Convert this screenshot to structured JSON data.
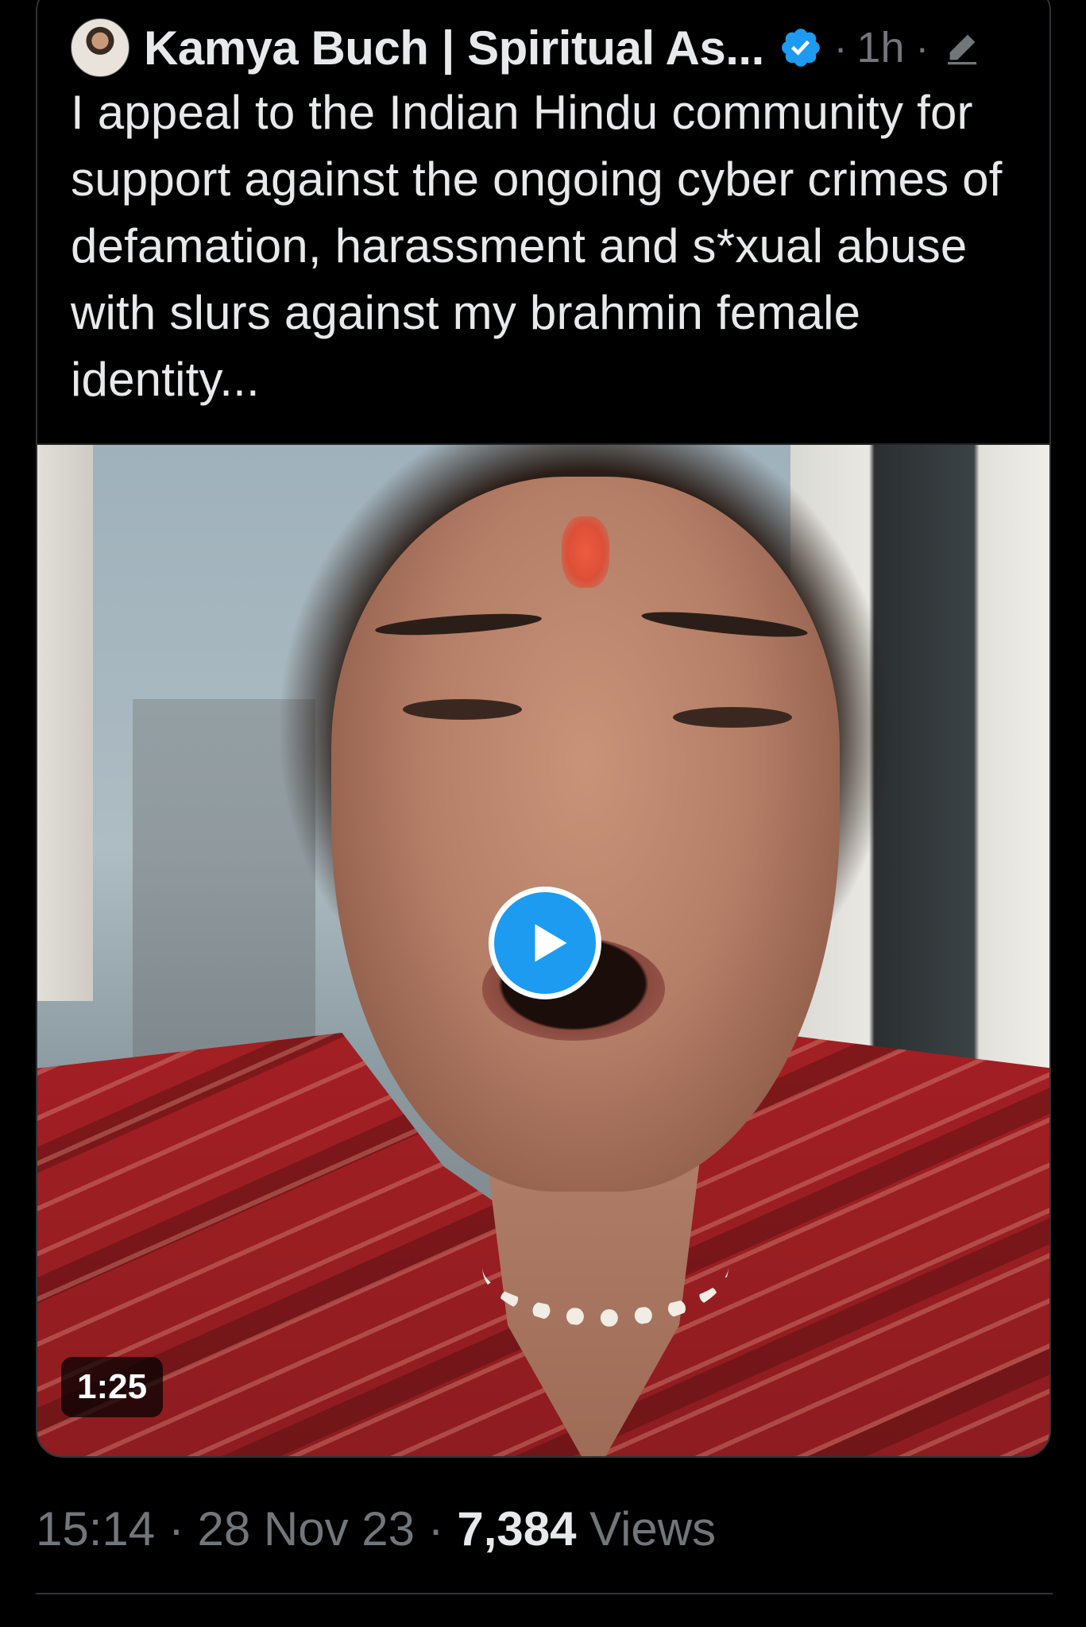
{
  "quoted_tweet": {
    "author_display_name": "Kamya Buch | Spiritual As...",
    "time_ago": "1h",
    "separator": "·",
    "text": "I appeal to the Indian Hindu community for support against the ongoing cyber crimes of defamation, harassment and s*xual abuse with slurs against my brahmin female identity...",
    "video": {
      "duration": "1:25"
    }
  },
  "tweet_meta": {
    "time": "15:14",
    "date": "28 Nov 23",
    "separator": "·",
    "views_count": "7,384",
    "views_label": "Views"
  },
  "colors": {
    "background": "#000000",
    "primary_text": "#e7e9ea",
    "secondary_text": "#71767b",
    "accent": "#1d9bf0",
    "border": "#2f3336"
  },
  "icons": {
    "verified": "verified-badge-icon",
    "edit": "edit-pencil-icon",
    "play": "play-icon"
  }
}
